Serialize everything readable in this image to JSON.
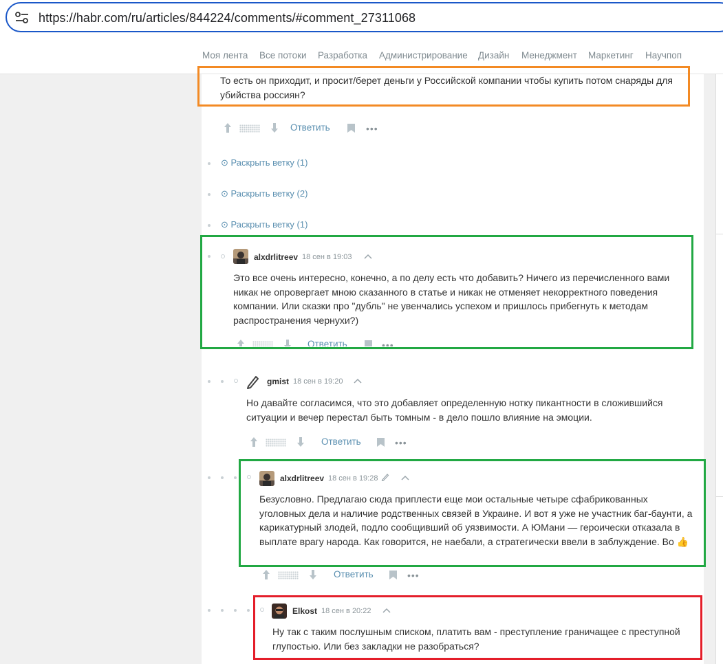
{
  "browser": {
    "url": "https://habr.com/ru/articles/844224/comments/#comment_27311068"
  },
  "nav": {
    "items": [
      "Моя лента",
      "Все потоки",
      "Разработка",
      "Администрирование",
      "Дизайн",
      "Менеджмент",
      "Маркетинг",
      "Научпоп"
    ]
  },
  "actions": {
    "reply_label": "Ответить",
    "more_label": "•••"
  },
  "first_comment": {
    "text_line1": "То есть он приходит, и просит/берет деньги у Российской компании чтобы купить потом снаряды для",
    "text_line2": "убийства россиян?"
  },
  "expand": [
    {
      "label": "⊙ Раскрыть ветку (1)"
    },
    {
      "label": "⊙ Раскрыть ветку (2)"
    },
    {
      "label": "⊙ Раскрыть ветку (1)"
    }
  ],
  "comments": [
    {
      "author": "alxdrlitreev",
      "time": "18 сен в 19:03",
      "lines": [
        "Это все очень интересно, конечно, а по делу есть что добавить? Ничего из перечисленного вами",
        "никак не опровергает мною сказанного в статье и никак не отменяет некорректного поведения",
        "компании. Или сказки про \"дубль\" не увенчались успехом и пришлось прибегнуть к методам",
        "распространения чернухи?)"
      ]
    },
    {
      "author": "gmist",
      "time": "18 сен в 19:20",
      "lines": [
        "Но давайте согласимся, что это добавляет определенную нотку пикантности в сложившийся",
        "ситуации и вечер перестал быть томным - в дело пошло влияние на эмоции."
      ]
    },
    {
      "author": "alxdrlitreev",
      "time": "18 сен в 19:28",
      "lines": [
        "Безусловно. Предлагаю сюда приплести еще мои остальные четыре сфабрикованных",
        "уголовных дела и наличие родственных связей в Украине. И вот я уже не участник баг-баунти, а",
        "карикатурный злодей, подло сообщивший об уязвимости. А ЮМани — героически отказала в",
        "выплате врагу народа. Как говорится, не наебали, а стратегически ввели в заблуждение. Во 👍"
      ]
    },
    {
      "author": "Elkost",
      "time": "18 сен в 20:22",
      "lines": [
        "Ну так с таким послушным списком, платить вам - преступление граничащее с преступной",
        "глупостью. Или без закладки не разобраться?"
      ]
    }
  ],
  "colors": {
    "highlight_orange": "#f38a24",
    "highlight_green": "#21a843",
    "highlight_red": "#e41e2a",
    "link": "#5a8fb0"
  }
}
